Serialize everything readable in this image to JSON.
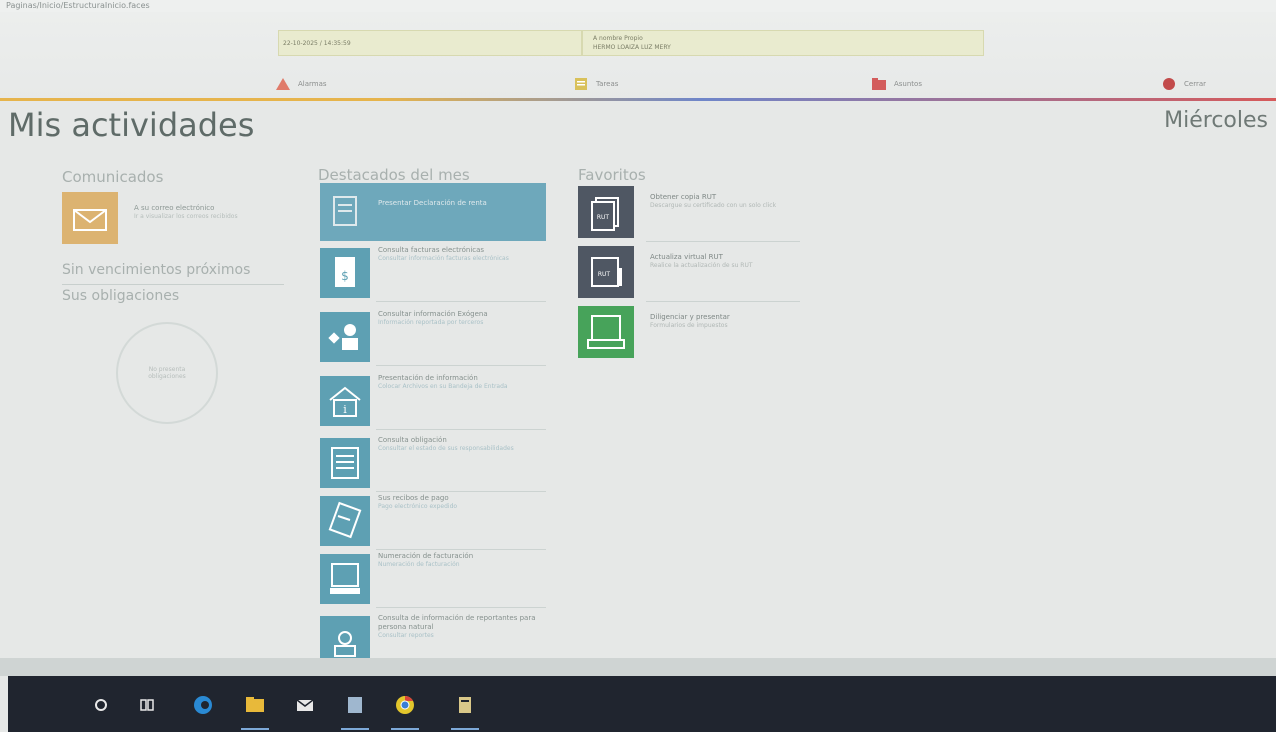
{
  "address_bar": "Paginas/Inicio/EstructuraInicio.faces",
  "header": {
    "datetime": "22-10-2025 / 14:35:59",
    "user_label": "A nombre Propio",
    "user_name": "HERMO LOAIZA LUZ MERY",
    "nav": [
      {
        "label": "Alarmas",
        "icon": "warning-icon",
        "color": "#e07b6a"
      },
      {
        "label": "Tareas",
        "icon": "list-icon",
        "color": "#d9c15a"
      },
      {
        "label": "Asuntos",
        "icon": "folder-icon",
        "color": "#d35c5c"
      },
      {
        "label": "Cerrar",
        "icon": "power-icon",
        "color": "#c24b4b"
      }
    ]
  },
  "page": {
    "title": "Mis actividades",
    "day": "Miércoles"
  },
  "comunicados": {
    "title": "Comunicados",
    "card_title": "A su correo electrónico",
    "card_sub": "Ir a visualizar los correos recibidos",
    "icon": "mail-icon"
  },
  "sin_vencimientos": "Sin vencimientos próximos",
  "obligaciones": {
    "title": "Sus obligaciones",
    "empty": "No presenta obligaciones"
  },
  "destacados": {
    "title": "Destacados del mes",
    "items": [
      {
        "title": "Presentar Declaración de renta",
        "sub": "",
        "icon": "form-icon"
      },
      {
        "title": "Consulta facturas electrónicas",
        "sub": "Consultar información facturas electrónicas",
        "icon": "invoice-icon"
      },
      {
        "title": "Consultar información Exógena",
        "sub": "Información reportada por terceros",
        "icon": "people-icon"
      },
      {
        "title": "Presentación de información",
        "sub": "Colocar Archivos en su Bandeja de Entrada",
        "icon": "info-icon"
      },
      {
        "title": "Consulta obligación",
        "sub": "Consultar el estado de sus responsabilidades",
        "icon": "document-icon"
      },
      {
        "title": "Sus recibos de pago",
        "sub": "Pago electrónico expedido",
        "icon": "receipt-icon"
      },
      {
        "title": "Numeración de facturación",
        "sub": "Numeración de facturación",
        "icon": "numbering-icon"
      },
      {
        "title": "Consulta de información de reportantes para persona natural",
        "sub": "Consultar reportes",
        "icon": "person-icon"
      }
    ]
  },
  "favoritos": {
    "title": "Favoritos",
    "items": [
      {
        "title": "Obtener copia RUT",
        "sub": "Descargue su certificado con un solo click",
        "icon": "rut-copy-icon",
        "color": "#4f5763"
      },
      {
        "title": "Actualiza virtual RUT",
        "sub": "Realice la actualización de su RUT",
        "icon": "rut-update-icon",
        "color": "#4f5763"
      },
      {
        "title": "Diligenciar y presentar",
        "sub": "Formularios de impuestos",
        "icon": "form-fill-icon",
        "color": "#47a35a"
      }
    ]
  },
  "taskbar": {
    "icons": [
      "search-icon",
      "task-view-icon",
      "edge-icon",
      "file-explorer-icon",
      "mail-app-icon",
      "app-icon",
      "chrome-icon",
      "files-icon"
    ]
  }
}
